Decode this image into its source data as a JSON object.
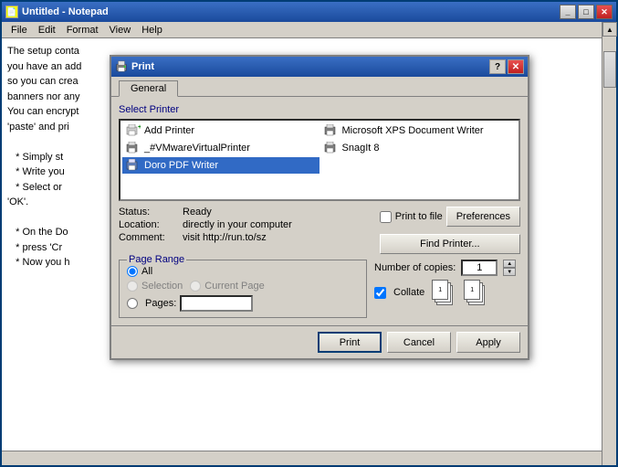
{
  "notepad": {
    "title": "Untitled - Notepad",
    "menu": [
      "File",
      "Edit",
      "Format",
      "View",
      "Help"
    ],
    "content": "The setup conta\nyou have an add\nso you can crea\nbanners nor any\nYou can encrypt\n'paste' and pri\n\n   * Simply st\n   * Write you\n   * Select or\n'OK'.\n\n   * On the Do\n   * press 'Cr\n   * Now you h"
  },
  "dialog": {
    "title": "Print",
    "tabs": [
      {
        "label": "General",
        "active": true
      }
    ],
    "sections": {
      "select_printer": "Select Printer",
      "printers": [
        {
          "name": "Add Printer",
          "type": "add"
        },
        {
          "name": "Microsoft XPS Document Writer",
          "type": "xps"
        },
        {
          "name": "_#VMwareVirtualPrinter",
          "type": "vmware"
        },
        {
          "name": "SnagIt 8",
          "type": "snagit"
        },
        {
          "name": "Doro PDF Writer",
          "type": "doro",
          "selected": true
        }
      ],
      "status": {
        "label": "Status:",
        "value": "Ready",
        "location_label": "Location:",
        "location_value": "directly in your computer",
        "comment_label": "Comment:",
        "comment_value": "visit http://run.to/sz"
      },
      "print_to_file_label": "Print to file",
      "preferences_label": "Preferences",
      "find_printer_label": "Find Printer...",
      "page_range": {
        "legend": "Page Range",
        "all_label": "All",
        "selection_label": "Selection",
        "current_page_label": "Current Page",
        "pages_label": "Pages:",
        "pages_value": ""
      },
      "copies": {
        "label": "Number of copies:",
        "value": "1",
        "collate_label": "Collate"
      }
    },
    "buttons": {
      "print": "Print",
      "cancel": "Cancel",
      "apply": "Apply"
    }
  }
}
